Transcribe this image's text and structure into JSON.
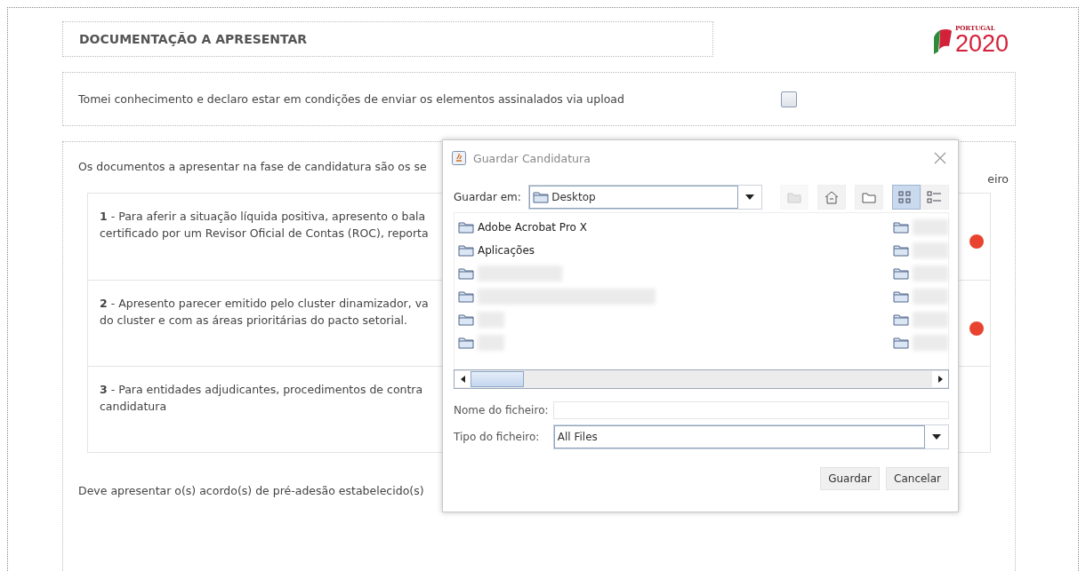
{
  "header": {
    "title": "DOCUMENTAÇÃO A APRESENTAR"
  },
  "logo": {
    "top": "PORTUGAL",
    "main": "2020"
  },
  "declaration": {
    "text": "Tomei conhecimento e declaro estar em condições de enviar os elementos assinalados via upload",
    "checked": false
  },
  "documents": {
    "intro": "Os documentos a apresentar na fase de candidatura são os se",
    "column_label": "eiro",
    "items": [
      {
        "lines": [
          "**1** - Para aferir a situação líquida positiva, apresento o bala",
          "certificado por um Revisor Oficial de Contas (ROC), reporta"
        ],
        "flagged": true
      },
      {
        "lines": [
          "**2** - Apresento parecer emitido pelo cluster dinamizador, va",
          "do cluster e com as áreas prioritárias do pacto setorial."
        ],
        "flagged": true
      },
      {
        "lines": [
          "**3** - Para entidades adjudicantes, procedimentos de contra",
          "candidatura"
        ],
        "flagged": false
      }
    ],
    "footer": "Deve apresentar o(s) acordo(s) de pré-adesão estabelecido(s)"
  },
  "dialog": {
    "title": "Guardar Candidatura",
    "look_in_label": "Guardar em:",
    "look_in_value": "Desktop",
    "toolbar": [
      {
        "kind": "up",
        "disabled": true,
        "selected": false
      },
      {
        "kind": "home",
        "disabled": false,
        "selected": false
      },
      {
        "kind": "new-folder",
        "disabled": false,
        "selected": false
      },
      {
        "kind": "list",
        "disabled": false,
        "selected": true
      },
      {
        "kind": "details",
        "disabled": false,
        "selected": false
      }
    ],
    "columns": [
      [
        {
          "kind": "named",
          "name": "Adobe Acrobat Pro X"
        },
        {
          "kind": "named",
          "name": "Aplicações"
        },
        {
          "kind": "blurred"
        },
        {
          "kind": "blurred"
        },
        {
          "kind": "blurred"
        },
        {
          "kind": "blurred"
        }
      ],
      [
        {
          "kind": "blurred"
        },
        {
          "kind": "blurred"
        },
        {
          "kind": "blurred"
        },
        {
          "kind": "blurred"
        },
        {
          "kind": "blurred"
        },
        {
          "kind": "blurred"
        }
      ]
    ],
    "file_name_label": "Nome do ficheiro:",
    "file_type_label": "Tipo do ficheiro:",
    "file_type_value": "All Files",
    "buttons": [
      "Guardar",
      "Cancelar"
    ]
  }
}
